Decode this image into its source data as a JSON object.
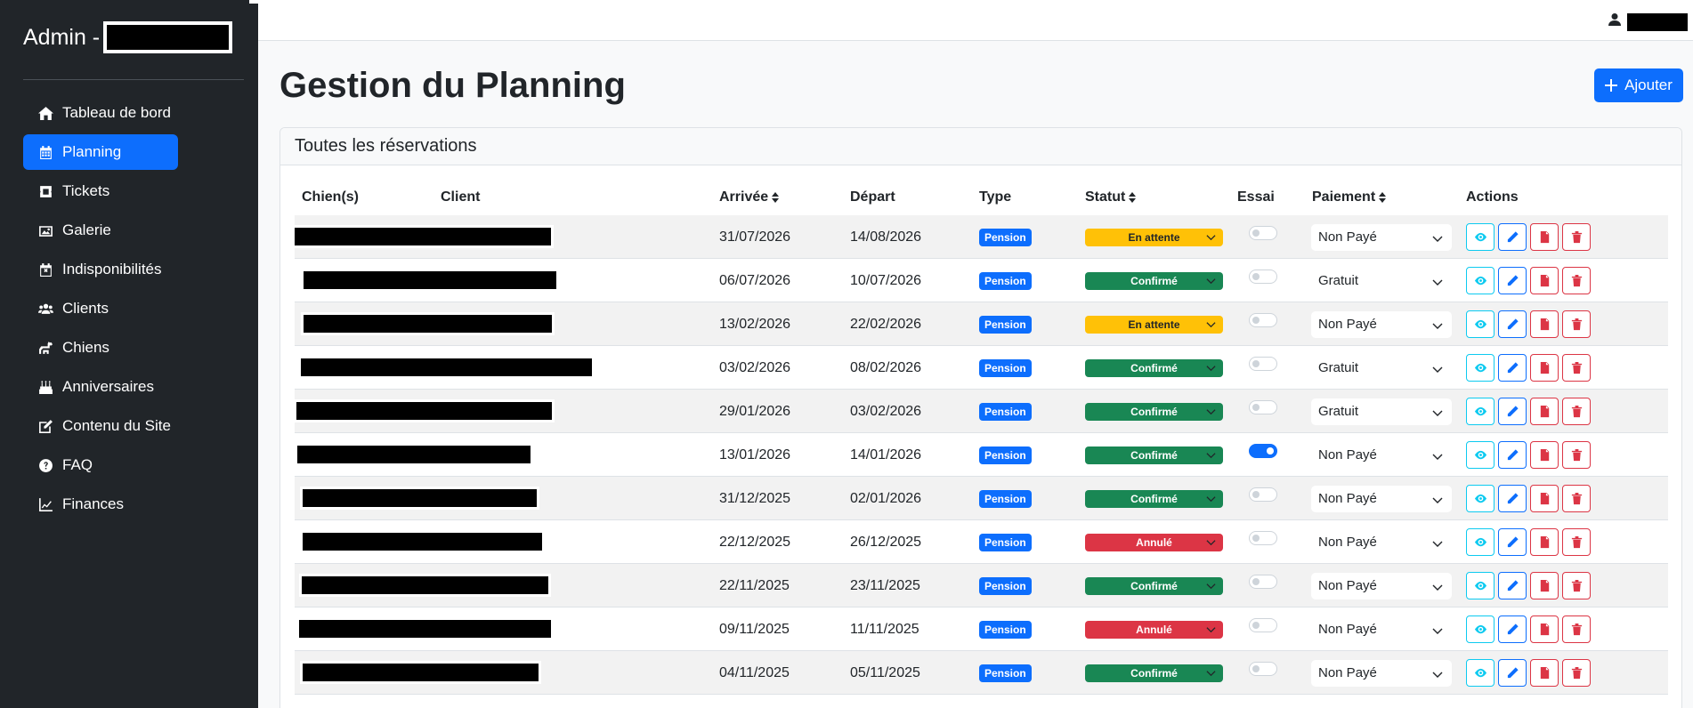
{
  "sidebar": {
    "brand": "Admin -",
    "items": [
      {
        "label": "Tableau de bord",
        "icon": "home-icon",
        "active": false
      },
      {
        "label": "Planning",
        "icon": "calendar-icon",
        "active": true
      },
      {
        "label": "Tickets",
        "icon": "ticket-icon",
        "active": false
      },
      {
        "label": "Galerie",
        "icon": "images-icon",
        "active": false
      },
      {
        "label": "Indisponibilités",
        "icon": "calendar-x-icon",
        "active": false
      },
      {
        "label": "Clients",
        "icon": "users-icon",
        "active": false
      },
      {
        "label": "Chiens",
        "icon": "dog-icon",
        "active": false
      },
      {
        "label": "Anniversaires",
        "icon": "cake-icon",
        "active": false
      },
      {
        "label": "Contenu du Site",
        "icon": "edit-icon",
        "active": false
      },
      {
        "label": "FAQ",
        "icon": "question-icon",
        "active": false
      },
      {
        "label": "Finances",
        "icon": "chart-line-icon",
        "active": false
      }
    ]
  },
  "header": {
    "user_icon": "user-icon"
  },
  "main": {
    "title": "Gestion du Planning",
    "add_label": "Ajouter",
    "card_title": "Toutes les réservations",
    "columns": {
      "dogs": "Chien(s)",
      "client": "Client",
      "arrival": "Arrivée",
      "departure": "Départ",
      "type": "Type",
      "status": "Statut",
      "trial": "Essai",
      "payment": "Paiement",
      "actions": "Actions"
    },
    "rows": [
      {
        "arrival": "31/07/2026",
        "departure": "14/08/2026",
        "type": "Pension",
        "status": "En attente",
        "status_kind": "warning",
        "trial": false,
        "payment": "Non Payé"
      },
      {
        "arrival": "06/07/2026",
        "departure": "10/07/2026",
        "type": "Pension",
        "status": "Confirmé",
        "status_kind": "success",
        "trial": false,
        "payment": "Gratuit"
      },
      {
        "arrival": "13/02/2026",
        "departure": "22/02/2026",
        "type": "Pension",
        "status": "En attente",
        "status_kind": "warning",
        "trial": false,
        "payment": "Non Payé"
      },
      {
        "arrival": "03/02/2026",
        "departure": "08/02/2026",
        "type": "Pension",
        "status": "Confirmé",
        "status_kind": "success",
        "trial": false,
        "payment": "Gratuit"
      },
      {
        "arrival": "29/01/2026",
        "departure": "03/02/2026",
        "type": "Pension",
        "status": "Confirmé",
        "status_kind": "success",
        "trial": false,
        "payment": "Gratuit"
      },
      {
        "arrival": "13/01/2026",
        "departure": "14/01/2026",
        "type": "Pension",
        "status": "Confirmé",
        "status_kind": "success",
        "trial": true,
        "payment": "Non Payé"
      },
      {
        "arrival": "31/12/2025",
        "departure": "02/01/2026",
        "type": "Pension",
        "status": "Confirmé",
        "status_kind": "success",
        "trial": false,
        "payment": "Non Payé"
      },
      {
        "arrival": "22/12/2025",
        "departure": "26/12/2025",
        "type": "Pension",
        "status": "Annulé",
        "status_kind": "danger",
        "trial": false,
        "payment": "Non Payé"
      },
      {
        "arrival": "22/11/2025",
        "departure": "23/11/2025",
        "type": "Pension",
        "status": "Confirmé",
        "status_kind": "success",
        "trial": false,
        "payment": "Non Payé"
      },
      {
        "arrival": "09/11/2025",
        "departure": "11/11/2025",
        "type": "Pension",
        "status": "Annulé",
        "status_kind": "danger",
        "trial": false,
        "payment": "Non Payé"
      },
      {
        "arrival": "04/11/2025",
        "departure": "05/11/2025",
        "type": "Pension",
        "status": "Confirmé",
        "status_kind": "success",
        "trial": false,
        "payment": "Non Payé"
      }
    ]
  }
}
